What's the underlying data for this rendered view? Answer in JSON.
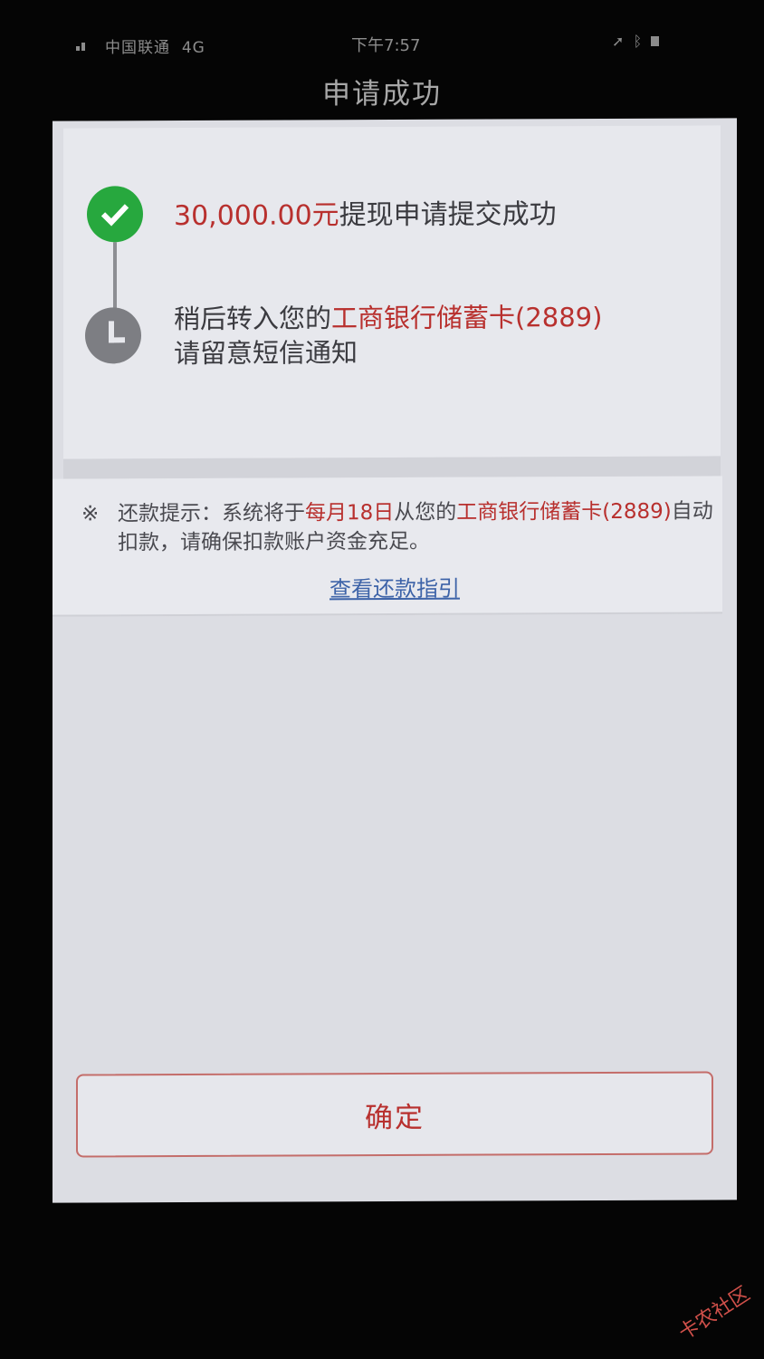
{
  "status_bar": {
    "carrier": "中国联通",
    "network": "4G",
    "time": "下午7:57"
  },
  "header": {
    "title": "申请成功"
  },
  "steps": [
    {
      "amount": "30,000.00元",
      "text": "提现申请提交成功",
      "status_color": "#27a83e"
    },
    {
      "prefix": "稍后转入您的",
      "bank": "工商银行储蓄卡(2889)",
      "line2": "请留意短信通知",
      "status_color": "#7d7e83"
    }
  ],
  "repayment_tip": {
    "mark": "※",
    "label": "还款提示：系统将于",
    "date": "每月18日",
    "mid": "从您的",
    "bank": "工商银行储蓄卡(2889)",
    "tail": "自动扣款，请确保扣款账户资金充足。",
    "link": "查看还款指引"
  },
  "confirm_button": {
    "label": "确定"
  },
  "watermark": {
    "text": "卡农社区"
  },
  "colors": {
    "accent_red": "#b8302e",
    "success_green": "#27a83e",
    "link_blue": "#3d63a8"
  }
}
